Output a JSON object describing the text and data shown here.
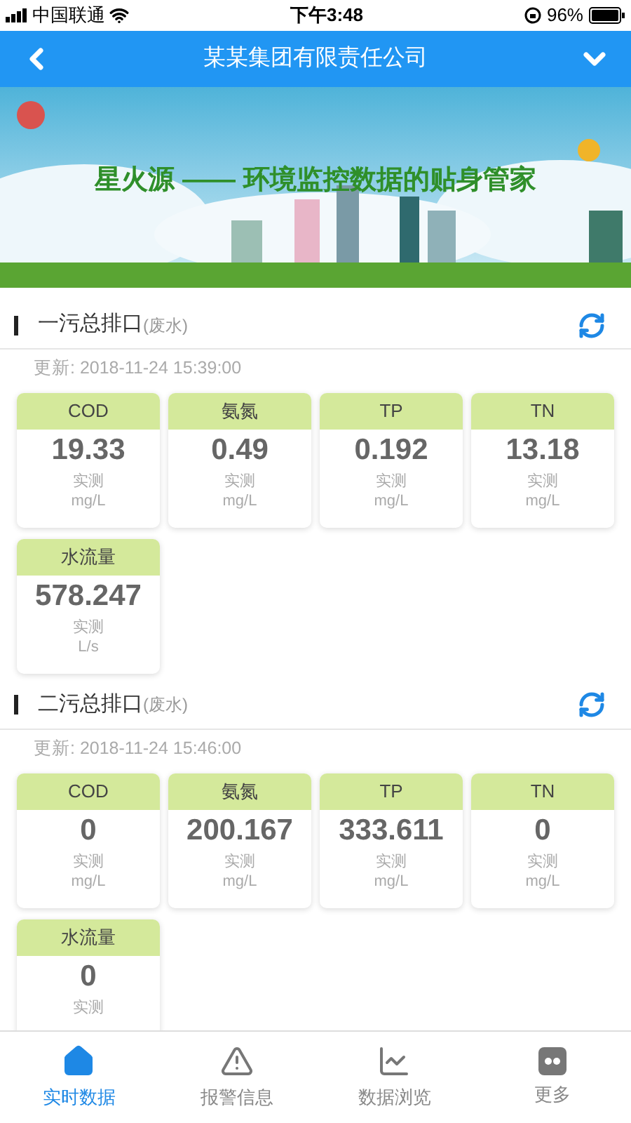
{
  "status_bar": {
    "carrier": "中国联通",
    "time": "下午3:48",
    "battery": "96%"
  },
  "header": {
    "title": "某某集团有限责任公司"
  },
  "banner": {
    "kind": "picture",
    "slogan": "星火源 —— 环境监控数据的贴身管家"
  },
  "sections": [
    {
      "name": "一污总排口",
      "type": "(废水)",
      "updated": "更新: 2018-11-24 15:39:00",
      "metrics": [
        {
          "label": "COD",
          "value": "19.33",
          "note": "实测",
          "unit": "mg/L"
        },
        {
          "label": "氨氮",
          "value": "0.49",
          "note": "实测",
          "unit": "mg/L"
        },
        {
          "label": "TP",
          "value": "0.192",
          "note": "实测",
          "unit": "mg/L"
        },
        {
          "label": "TN",
          "value": "13.18",
          "note": "实测",
          "unit": "mg/L"
        },
        {
          "label": "水流量",
          "value": "578.247",
          "note": "实测",
          "unit": "L/s"
        }
      ]
    },
    {
      "name": "二污总排口",
      "type": "(废水)",
      "updated": "更新: 2018-11-24 15:46:00",
      "metrics": [
        {
          "label": "COD",
          "value": "0",
          "note": "实测",
          "unit": "mg/L"
        },
        {
          "label": "氨氮",
          "value": "200.167",
          "note": "实测",
          "unit": "mg/L"
        },
        {
          "label": "TP",
          "value": "333.611",
          "note": "实测",
          "unit": "mg/L"
        },
        {
          "label": "TN",
          "value": "0",
          "note": "实测",
          "unit": "mg/L"
        },
        {
          "label": "水流量",
          "value": "0",
          "note": "实测"
        }
      ]
    }
  ],
  "tabs": [
    {
      "label": "实时数据",
      "kind": "home",
      "selected": true
    },
    {
      "label": "报警信息",
      "kind": "alert",
      "selected": false
    },
    {
      "label": "数据浏览",
      "kind": "chart",
      "selected": false
    },
    {
      "label": "更多",
      "kind": "more",
      "selected": false
    }
  ]
}
